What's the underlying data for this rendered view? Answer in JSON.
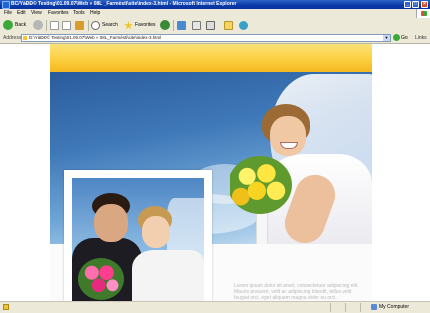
{
  "window": {
    "title": "BC/YàÐÐ© Testing\\01.09.07\\Web » 08L _Farmèsti\\site\\index-3.html - Microsoft Internet Explorer",
    "minimize_icon": "minimize-icon",
    "maximize_icon": "maximize-icon",
    "close_icon": "close-icon"
  },
  "menu": {
    "items": [
      "File",
      "Edit",
      "View",
      "Favorites",
      "Tools",
      "Help"
    ]
  },
  "toolbar": {
    "back_label": "Back",
    "search_label": "Search",
    "favorites_label": "Favorites"
  },
  "address": {
    "label": "Address",
    "value": "D:\\YàÐÐ© Testing\\01.09.07\\Web » 08L_Farmèsti\\site\\index-3.html",
    "go_label": "Go",
    "links_label": "Links"
  },
  "page": {
    "body_text": "Lorem ipsum dolor sit amet, consectetuer adipiscing elit. Mauris posuere, velit ac adipiscing blandit, tellus velit feugiat orci, eget aliquam magna dolor eu orci."
  },
  "status": {
    "zone": "My Computer"
  },
  "colors": {
    "header_yellow": "#fbcf3e",
    "sky_blue": "#3f78b8",
    "xp_title_blue": "#0a3aa8",
    "chrome_beige": "#ece9d8"
  }
}
